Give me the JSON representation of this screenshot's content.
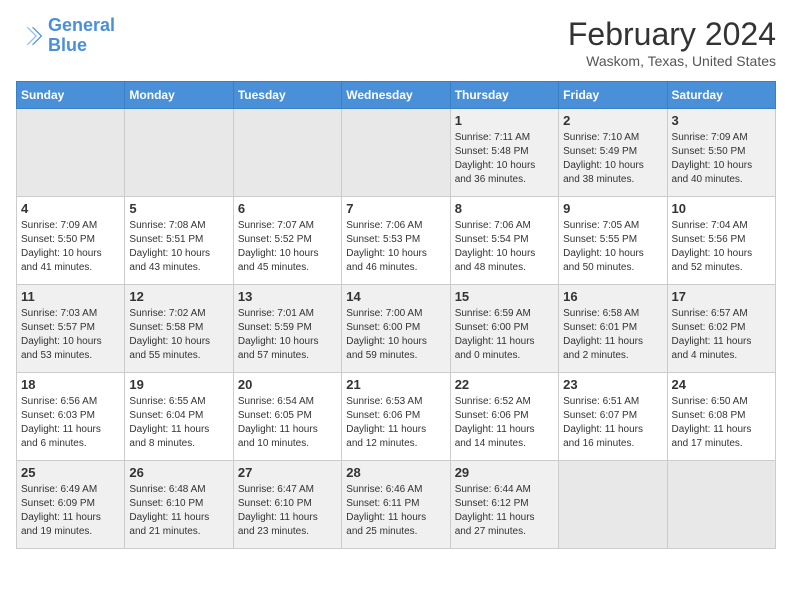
{
  "logo": {
    "line1": "General",
    "line2": "Blue"
  },
  "title": "February 2024",
  "subtitle": "Waskom, Texas, United States",
  "weekdays": [
    "Sunday",
    "Monday",
    "Tuesday",
    "Wednesday",
    "Thursday",
    "Friday",
    "Saturday"
  ],
  "weeks": [
    [
      {
        "day": "",
        "info": ""
      },
      {
        "day": "",
        "info": ""
      },
      {
        "day": "",
        "info": ""
      },
      {
        "day": "",
        "info": ""
      },
      {
        "day": "1",
        "info": "Sunrise: 7:11 AM\nSunset: 5:48 PM\nDaylight: 10 hours\nand 36 minutes."
      },
      {
        "day": "2",
        "info": "Sunrise: 7:10 AM\nSunset: 5:49 PM\nDaylight: 10 hours\nand 38 minutes."
      },
      {
        "day": "3",
        "info": "Sunrise: 7:09 AM\nSunset: 5:50 PM\nDaylight: 10 hours\nand 40 minutes."
      }
    ],
    [
      {
        "day": "4",
        "info": "Sunrise: 7:09 AM\nSunset: 5:50 PM\nDaylight: 10 hours\nand 41 minutes."
      },
      {
        "day": "5",
        "info": "Sunrise: 7:08 AM\nSunset: 5:51 PM\nDaylight: 10 hours\nand 43 minutes."
      },
      {
        "day": "6",
        "info": "Sunrise: 7:07 AM\nSunset: 5:52 PM\nDaylight: 10 hours\nand 45 minutes."
      },
      {
        "day": "7",
        "info": "Sunrise: 7:06 AM\nSunset: 5:53 PM\nDaylight: 10 hours\nand 46 minutes."
      },
      {
        "day": "8",
        "info": "Sunrise: 7:06 AM\nSunset: 5:54 PM\nDaylight: 10 hours\nand 48 minutes."
      },
      {
        "day": "9",
        "info": "Sunrise: 7:05 AM\nSunset: 5:55 PM\nDaylight: 10 hours\nand 50 minutes."
      },
      {
        "day": "10",
        "info": "Sunrise: 7:04 AM\nSunset: 5:56 PM\nDaylight: 10 hours\nand 52 minutes."
      }
    ],
    [
      {
        "day": "11",
        "info": "Sunrise: 7:03 AM\nSunset: 5:57 PM\nDaylight: 10 hours\nand 53 minutes."
      },
      {
        "day": "12",
        "info": "Sunrise: 7:02 AM\nSunset: 5:58 PM\nDaylight: 10 hours\nand 55 minutes."
      },
      {
        "day": "13",
        "info": "Sunrise: 7:01 AM\nSunset: 5:59 PM\nDaylight: 10 hours\nand 57 minutes."
      },
      {
        "day": "14",
        "info": "Sunrise: 7:00 AM\nSunset: 6:00 PM\nDaylight: 10 hours\nand 59 minutes."
      },
      {
        "day": "15",
        "info": "Sunrise: 6:59 AM\nSunset: 6:00 PM\nDaylight: 11 hours\nand 0 minutes."
      },
      {
        "day": "16",
        "info": "Sunrise: 6:58 AM\nSunset: 6:01 PM\nDaylight: 11 hours\nand 2 minutes."
      },
      {
        "day": "17",
        "info": "Sunrise: 6:57 AM\nSunset: 6:02 PM\nDaylight: 11 hours\nand 4 minutes."
      }
    ],
    [
      {
        "day": "18",
        "info": "Sunrise: 6:56 AM\nSunset: 6:03 PM\nDaylight: 11 hours\nand 6 minutes."
      },
      {
        "day": "19",
        "info": "Sunrise: 6:55 AM\nSunset: 6:04 PM\nDaylight: 11 hours\nand 8 minutes."
      },
      {
        "day": "20",
        "info": "Sunrise: 6:54 AM\nSunset: 6:05 PM\nDaylight: 11 hours\nand 10 minutes."
      },
      {
        "day": "21",
        "info": "Sunrise: 6:53 AM\nSunset: 6:06 PM\nDaylight: 11 hours\nand 12 minutes."
      },
      {
        "day": "22",
        "info": "Sunrise: 6:52 AM\nSunset: 6:06 PM\nDaylight: 11 hours\nand 14 minutes."
      },
      {
        "day": "23",
        "info": "Sunrise: 6:51 AM\nSunset: 6:07 PM\nDaylight: 11 hours\nand 16 minutes."
      },
      {
        "day": "24",
        "info": "Sunrise: 6:50 AM\nSunset: 6:08 PM\nDaylight: 11 hours\nand 17 minutes."
      }
    ],
    [
      {
        "day": "25",
        "info": "Sunrise: 6:49 AM\nSunset: 6:09 PM\nDaylight: 11 hours\nand 19 minutes."
      },
      {
        "day": "26",
        "info": "Sunrise: 6:48 AM\nSunset: 6:10 PM\nDaylight: 11 hours\nand 21 minutes."
      },
      {
        "day": "27",
        "info": "Sunrise: 6:47 AM\nSunset: 6:10 PM\nDaylight: 11 hours\nand 23 minutes."
      },
      {
        "day": "28",
        "info": "Sunrise: 6:46 AM\nSunset: 6:11 PM\nDaylight: 11 hours\nand 25 minutes."
      },
      {
        "day": "29",
        "info": "Sunrise: 6:44 AM\nSunset: 6:12 PM\nDaylight: 11 hours\nand 27 minutes."
      },
      {
        "day": "",
        "info": ""
      },
      {
        "day": "",
        "info": ""
      }
    ]
  ]
}
